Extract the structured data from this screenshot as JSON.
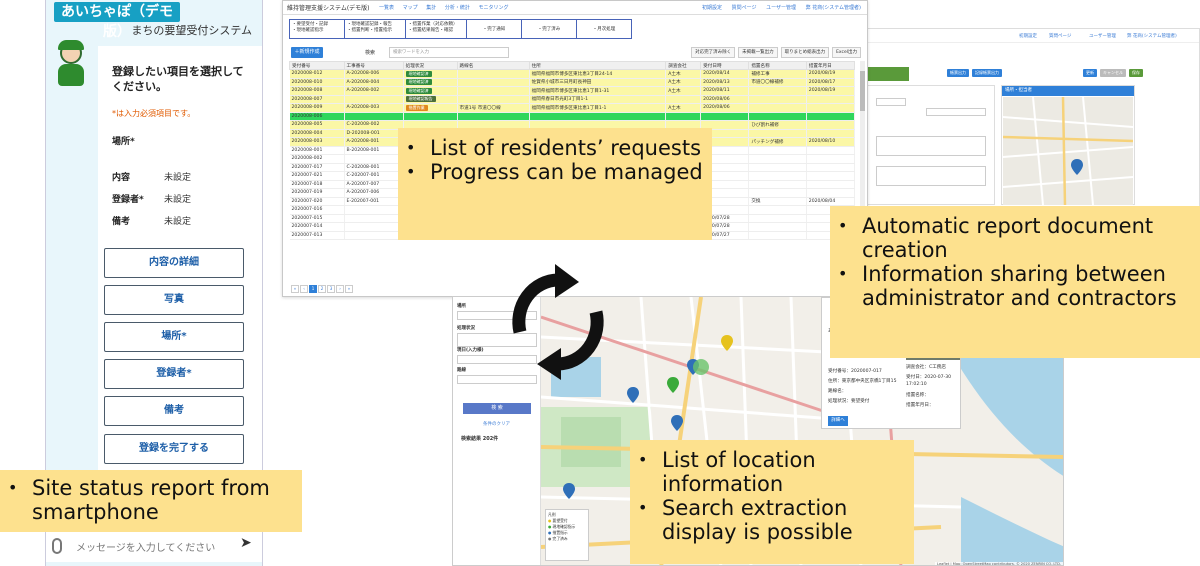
{
  "phone": {
    "title": "あいちゃぽ（デモ版）",
    "subtitle": "まちの要望受付システム",
    "prompt": "登録したい項目を選択してください。",
    "required_note": "*は入力必須項目です。",
    "fields": [
      {
        "label": "場所*",
        "value": ""
      },
      {
        "label": "内容",
        "value": "未設定"
      },
      {
        "label": "登録者*",
        "value": "未設定"
      },
      {
        "label": "備考",
        "value": "未設定"
      }
    ],
    "buttons": [
      "内容の詳細",
      "写真",
      "場所*",
      "登録者*",
      "備考",
      "登録を完了する"
    ],
    "message_placeholder": "メッセージを入力してください"
  },
  "admin": {
    "title": "維持管理支援システム(デモ版)",
    "nav": [
      "一覧表",
      "マップ",
      "集計",
      "分析・統計",
      "モニタリング"
    ],
    "right_nav": [
      "初期設定",
      "質問ページ",
      "ユーザー管理",
      "弊 花商(システム管理者)"
    ],
    "process_steps": [
      "・要望受付・記録\n・現地確認指示",
      "・現地確認記録・報告\n・措置判断・措置指示",
      "・措置作業（対応依頼）\n・措置結果報告・確認",
      "・完了通知",
      "・完了済み",
      "・月次処理"
    ],
    "new_button": "＋新規作成",
    "search_label": "検索",
    "search_placeholder": "検索ワードを入力",
    "tool_buttons": [
      "対応完了済み除く",
      "未掲載一覧出力",
      "取りまとめ総表出力",
      "Excel出力"
    ],
    "columns": [
      "受付番号",
      "工事番号",
      "処理状況",
      "路線名",
      "住所",
      "調査会社",
      "受付日時",
      "措置名称",
      "措置年月日"
    ],
    "rows": [
      {
        "id": "2020008-012",
        "work": "A-202008-006",
        "status": "現地確認済",
        "st": "g",
        "route": "",
        "addr": "福岡県福岡市博多区東比恵3丁目24-14",
        "co": "A土木",
        "date": "2020/08/14",
        "name": "補修工事",
        "done": "2020/08/19",
        "hl": "yellow"
      },
      {
        "id": "2020008-010",
        "work": "A-202008-004",
        "status": "現地確認済",
        "st": "g",
        "route": "",
        "addr": "佐賀県小城市三日月町長神田",
        "co": "A土木",
        "date": "2020/08/13",
        "name": "市道〇〇線補修",
        "done": "2020/08/17",
        "hl": "yellow"
      },
      {
        "id": "2020008-008",
        "work": "A-202008-002",
        "status": "現地確認済",
        "st": "g",
        "route": "",
        "addr": "福岡県福岡市博多区東比恵1丁目1-31",
        "co": "A土木",
        "date": "2020/08/11",
        "name": "",
        "done": "2020/08/19",
        "hl": "yellow"
      },
      {
        "id": "2020008-007",
        "work": "",
        "status": "現地確認報告",
        "st": "dg",
        "route": "",
        "addr": "福岡県春日市光町3丁目1-1",
        "co": "",
        "date": "2020/08/06",
        "name": "",
        "done": "",
        "hl": "yellow"
      },
      {
        "id": "2020008-009",
        "work": "A-202008-003",
        "status": "措置作業",
        "st": "o",
        "route": "市道1号 市道〇〇線",
        "addr": "福岡県福岡市博多区東比恵1丁目1-1",
        "co": "A土木",
        "date": "2020/08/06",
        "name": "",
        "done": "",
        "hl": "yellow"
      },
      {
        "id": "2020008-006",
        "work": "",
        "status": "",
        "st": "",
        "route": "",
        "addr": "",
        "co": "",
        "date": "",
        "name": "",
        "done": "",
        "hl": "green"
      },
      {
        "id": "2020008-005",
        "work": "C-202008-002",
        "status": "",
        "st": "",
        "route": "",
        "addr": "",
        "co": "",
        "date": "",
        "name": "ひび割れ補修",
        "done": "",
        "hl": "yellow"
      },
      {
        "id": "2020008-004",
        "work": "D-202008-001",
        "status": "",
        "st": "",
        "route": "",
        "addr": "",
        "co": "",
        "date": "",
        "name": "",
        "done": "",
        "hl": "yellow"
      },
      {
        "id": "2020008-003",
        "work": "A-202008-001",
        "status": "",
        "st": "",
        "route": "",
        "addr": "",
        "co": "",
        "date": "",
        "name": "パッチング補修",
        "done": "2020/08/10",
        "hl": "yellow"
      },
      {
        "id": "2020008-001",
        "work": "B-202008-001",
        "status": "",
        "st": "",
        "route": "",
        "addr": "",
        "co": "",
        "date": "",
        "name": "",
        "done": "",
        "hl": ""
      },
      {
        "id": "2020008-002",
        "work": "",
        "status": "",
        "st": "",
        "route": "",
        "addr": "",
        "co": "",
        "date": "",
        "name": "",
        "done": "",
        "hl": ""
      },
      {
        "id": "2020007-017",
        "work": "C-202008-001",
        "status": "",
        "st": "",
        "route": "",
        "addr": "",
        "co": "",
        "date": "",
        "name": "",
        "done": "",
        "hl": ""
      },
      {
        "id": "2020007-021",
        "work": "C-202007-001",
        "status": "",
        "st": "",
        "route": "",
        "addr": "",
        "co": "",
        "date": "",
        "name": "",
        "done": "",
        "hl": ""
      },
      {
        "id": "2020007-018",
        "work": "A-202007-007",
        "status": "",
        "st": "",
        "route": "",
        "addr": "",
        "co": "",
        "date": "",
        "name": "",
        "done": "",
        "hl": ""
      },
      {
        "id": "2020007-019",
        "work": "A-202007-006",
        "status": "",
        "st": "",
        "route": "",
        "addr": "",
        "co": "",
        "date": "",
        "name": "",
        "done": "",
        "hl": ""
      },
      {
        "id": "2020007-020",
        "work": "E-202007-001",
        "status": "",
        "st": "",
        "route": "",
        "addr": "",
        "co": "",
        "date": "",
        "name": "交換",
        "done": "2020/08/04",
        "hl": ""
      },
      {
        "id": "2020007-016",
        "work": "",
        "status": "",
        "st": "",
        "route": "",
        "addr": "",
        "co": "",
        "date": "",
        "name": "",
        "done": "",
        "hl": ""
      },
      {
        "id": "2020007-015",
        "work": "",
        "status": "措置作業",
        "st": "o",
        "route": "",
        "addr": "東京都中央区銀座1丁目",
        "co": "",
        "date": "2020/07/28",
        "name": "",
        "done": "",
        "hl": ""
      },
      {
        "id": "2020007-014",
        "work": "",
        "status": "現地確認報告",
        "st": "dg",
        "route": "",
        "addr": "東京都中央区銀座1丁目",
        "co": "",
        "date": "2020/07/28",
        "name": "",
        "done": "",
        "hl": ""
      },
      {
        "id": "2020007-013",
        "work": "",
        "status": "現地確認報告",
        "st": "dg",
        "route": "",
        "addr": "東京都中央区銀座1丁目",
        "co": "",
        "date": "2020/07/27",
        "name": "",
        "done": "",
        "hl": ""
      }
    ],
    "pager": [
      "«",
      "‹",
      "1",
      "2",
      "3",
      "›",
      "»"
    ],
    "pager_info": "1 - 100 of"
  },
  "report": {
    "nav": [
      "初期設定",
      "質問ページ",
      "ユーザー管理",
      "弊 花商(システム管理者)"
    ],
    "buttons": [
      "帳票出力",
      "記録帳票出力",
      "更新",
      "キャンセル",
      "保存"
    ],
    "panel_title": "場所・担当者",
    "labels": [
      "所在地",
      "管理者"
    ]
  },
  "map": {
    "side_labels": [
      "場所",
      "処理状況",
      "現日(入力様)",
      "路線"
    ],
    "search_button": "検 索",
    "clear_link": "条件のクリア",
    "count": "検索結果 202件",
    "popup": {
      "title": "あいちゃぽ写真(あいちゃぽ写真",
      "lines": [
        "受付番号：2020007-017",
        "住所：東京都中央区京橋1丁目15",
        "路線名：",
        "処理状況：要望受付"
      ],
      "right_lines": [
        "調査会社：C工務店",
        "受付日：2020-07-30",
        "17:02:10",
        "措置名称：",
        "措置年月日："
      ],
      "right_head": "サム",
      "detail_button": "詳細へ"
    },
    "legend": [
      "凡例",
      "要望受付",
      "現地確認指示",
      "措置指示",
      "完了済み"
    ],
    "credit": "Leaflet | Map: OpenStreetMap contributors, © 2020 ZENRIN CO.,LTD."
  },
  "callouts": {
    "residents": [
      "List of residents’ requests",
      "Progress can be managed"
    ],
    "report": [
      "Automatic report document creation",
      "Information sharing between administrator and contractors"
    ],
    "location": [
      "List of location information",
      "Search extraction display is possible"
    ],
    "smartphone": [
      "Site status report from smartphone"
    ]
  },
  "colors": {
    "callout_bg": "#fde18e",
    "phone_title_bg": "#17a0c4",
    "row_highlight": "#fbf7a6",
    "row_selected": "#2fd65c",
    "button_blue": "#2f80d8"
  }
}
